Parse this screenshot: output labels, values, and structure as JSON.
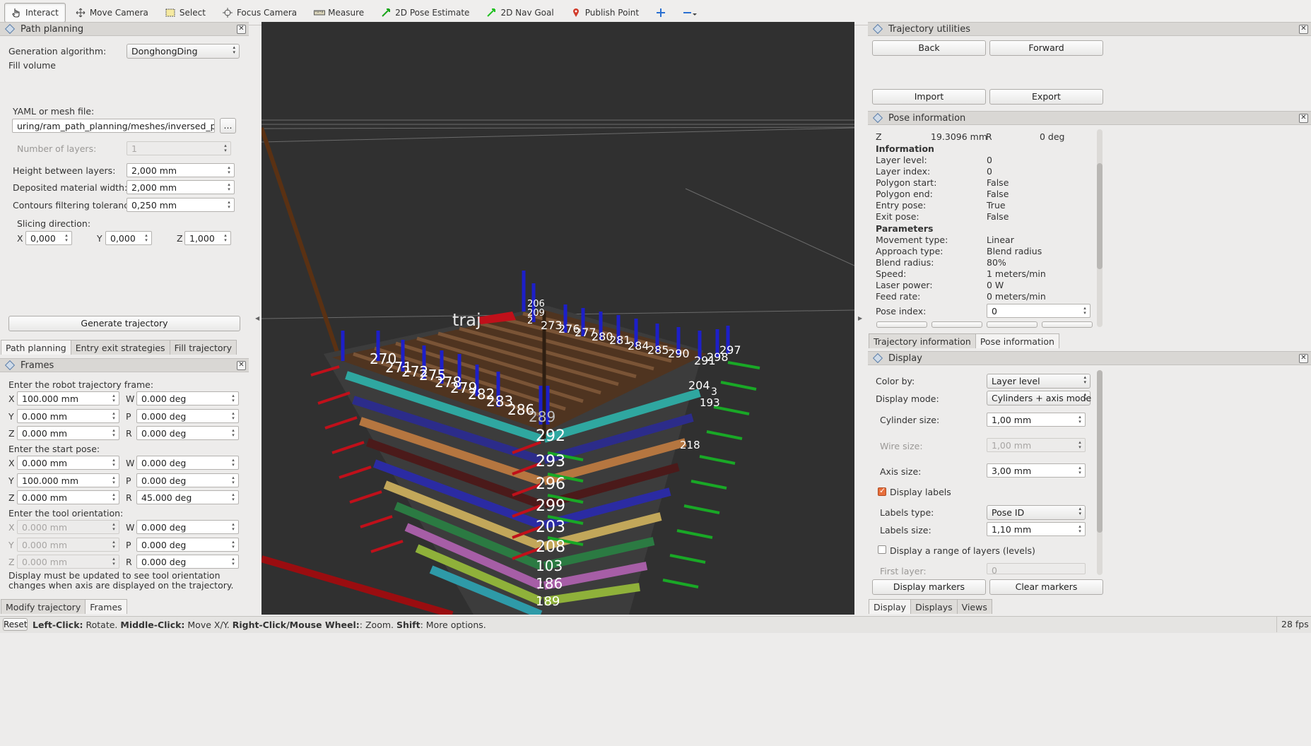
{
  "toolbar": {
    "interact": "Interact",
    "move_camera": "Move Camera",
    "select": "Select",
    "focus_camera": "Focus Camera",
    "measure": "Measure",
    "pose_estimate": "2D Pose Estimate",
    "nav_goal": "2D Nav Goal",
    "publish_point": "Publish Point"
  },
  "path_planning": {
    "title": "Path planning",
    "generation_algorithm_label": "Generation algorithm:",
    "generation_algorithm_value": "DonghongDing",
    "fill_volume": "Fill volume",
    "yaml_label": "YAML or mesh file:",
    "yaml_value": "uring/ram_path_planning/meshes/inversed_pyramid.ply",
    "browse": "...",
    "layers_label": "Number of layers:",
    "layers_value": "1",
    "height_label": "Height between layers:",
    "height_value": "2,000 mm",
    "width_label": "Deposited material width:",
    "width_value": "2,000 mm",
    "tolerance_label": "Contours filtering tolerance:",
    "tolerance_value": "0,250 mm",
    "slicing_label": "Slicing direction:",
    "slice_x_label": "X",
    "slice_x": "0,000",
    "slice_y_label": "Y",
    "slice_y": "0,000",
    "slice_z_label": "Z",
    "slice_z": "1,000",
    "generate": "Generate trajectory",
    "tabs": [
      "Path planning",
      "Entry exit strategies",
      "Fill trajectory"
    ]
  },
  "frames": {
    "title": "Frames",
    "robot_frame_label": "Enter the robot trajectory frame:",
    "robot": {
      "x": "100.000 mm",
      "y": "0.000 mm",
      "z": "0.000 mm",
      "w": "0.000 deg",
      "p": "0.000 deg",
      "r": "0.000 deg"
    },
    "start_label": "Enter the start pose:",
    "start": {
      "x": "0.000 mm",
      "y": "100.000 mm",
      "z": "0.000 mm",
      "w": "0.000 deg",
      "p": "0.000 deg",
      "r": "45.000 deg"
    },
    "tool_label": "Enter the tool orientation:",
    "tool": {
      "x": "0.000 mm",
      "y": "0.000 mm",
      "z": "0.000 mm",
      "w": "0.000 deg",
      "p": "0.000 deg",
      "r": "0.000 deg"
    },
    "axis_x": "X",
    "axis_y": "Y",
    "axis_z": "Z",
    "axis_w": "W",
    "axis_p": "P",
    "axis_r": "R",
    "note": "Display must be updated to see tool orientation changes when axis are displayed on the trajectory.",
    "tabs": [
      "Modify trajectory",
      "Frames"
    ]
  },
  "viewport": {
    "labels": [
      "206",
      "209",
      "2",
      "273",
      "276",
      "277",
      "280",
      "281",
      "284",
      "285",
      "290",
      "291",
      "297",
      "298",
      "270",
      "271",
      "272",
      "275",
      "278",
      "279",
      "282",
      "283",
      "286",
      "289",
      "292",
      "293",
      "296",
      "299",
      "204",
      "203",
      "208",
      "103",
      "186",
      "189",
      "193",
      "218",
      "3"
    ],
    "colors": {
      "background": "#303030",
      "layer_top": "#5a3a22",
      "accent_red": "#c0101a",
      "accent_green": "#19a826",
      "accent_blue": "#1d1fc8"
    }
  },
  "trajectory_utilities": {
    "title": "Trajectory utilities",
    "back": "Back",
    "forward": "Forward",
    "import": "Import",
    "export": "Export"
  },
  "pose_information": {
    "title": "Pose information",
    "z_label": "Z",
    "z_value": "19.3096 mm",
    "r_label": "R",
    "r_value": "0 deg",
    "information": "Information",
    "layer_level_label": "Layer level:",
    "layer_level": "0",
    "layer_index_label": "Layer index:",
    "layer_index": "0",
    "polygon_start_label": "Polygon start:",
    "polygon_start": "False",
    "polygon_end_label": "Polygon end:",
    "polygon_end": "False",
    "entry_pose_label": "Entry pose:",
    "entry_pose": "True",
    "exit_pose_label": "Exit pose:",
    "exit_pose": "False",
    "parameters": "Parameters",
    "movement_type_label": "Movement type:",
    "movement_type": "Linear",
    "approach_type_label": "Approach type:",
    "approach_type": "Blend radius",
    "blend_radius_label": "Blend radius:",
    "blend_radius": "80%",
    "speed_label": "Speed:",
    "speed": "1 meters/min",
    "laser_power_label": "Laser power:",
    "laser_power": "0 W",
    "feed_rate_label": "Feed rate:",
    "feed_rate": "0 meters/min",
    "pose_index_label": "Pose index:",
    "pose_index": "0",
    "tabs": [
      "Trajectory information",
      "Pose information"
    ]
  },
  "display": {
    "title": "Display",
    "color_by_label": "Color by:",
    "color_by": "Layer level",
    "display_mode_label": "Display mode:",
    "display_mode": "Cylinders + axis mode",
    "cylinder_size_label": "Cylinder size:",
    "cylinder_size": "1,00 mm",
    "wire_size_label": "Wire size:",
    "wire_size": "1,00 mm",
    "axis_size_label": "Axis size:",
    "axis_size": "3,00 mm",
    "display_labels": "Display labels",
    "labels_type_label": "Labels type:",
    "labels_type": "Pose ID",
    "labels_size_label": "Labels size:",
    "labels_size": "1,10 mm",
    "range_layers": "Display a range of layers (levels)",
    "first_layer_label": "First layer:",
    "first_layer": "0",
    "display_markers": "Display markers",
    "clear_markers": "Clear markers",
    "tabs": [
      "Display",
      "Displays",
      "Views"
    ]
  },
  "statusbar": {
    "reset": "Reset",
    "left_click": "Left-Click:",
    "left_click_desc": " Rotate. ",
    "middle_click": "Middle-Click:",
    "middle_click_desc": " Move X/Y. ",
    "right_click": "Right-Click/Mouse Wheel:",
    "right_click_desc": ": Zoom. ",
    "shift": "Shift",
    "shift_desc": ": More options.",
    "fps": "28 fps"
  }
}
